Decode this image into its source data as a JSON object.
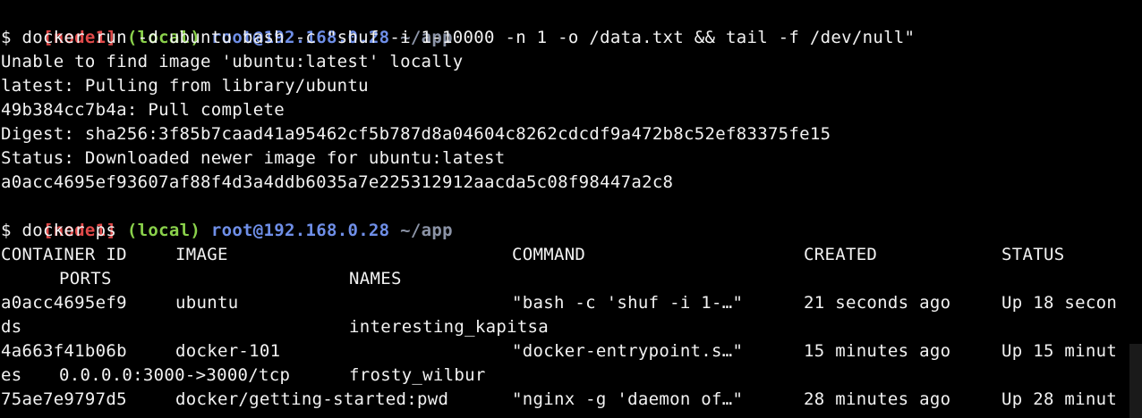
{
  "prompt": {
    "node": "[node1]",
    "local": "(local)",
    "host": "root@192.168.0.28",
    "path": "~/app"
  },
  "session": [
    {
      "kind": "prompt"
    },
    {
      "kind": "text",
      "text": "$ docker run -d ubuntu bash -c \"shuf -i 1-10000 -n 1 -o /data.txt && tail -f /dev/null\""
    },
    {
      "kind": "text",
      "text": "Unable to find image 'ubuntu:latest' locally"
    },
    {
      "kind": "text",
      "text": "latest: Pulling from library/ubuntu"
    },
    {
      "kind": "text",
      "text": "49b384cc7b4a: Pull complete"
    },
    {
      "kind": "text",
      "text": "Digest: sha256:3f85b7caad41a95462cf5b787d8a04604c8262cdcdf9a472b8c52ef83375fe15"
    },
    {
      "kind": "text",
      "text": "Status: Downloaded newer image for ubuntu:latest"
    },
    {
      "kind": "text",
      "text": "a0acc4695ef93607af88f4d3a4ddb6035a7e225312912aacda5c08f98447a2c8"
    },
    {
      "kind": "prompt"
    },
    {
      "kind": "text",
      "text": "$ docker ps"
    }
  ],
  "table": {
    "headers": [
      "CONTAINER ID",
      "IMAGE",
      "COMMAND",
      "CREATED",
      "STATUS"
    ],
    "headers_wrap": [
      "PORTS",
      "NAMES"
    ],
    "rows": [
      {
        "id": "a0acc4695ef9",
        "image": "ubuntu",
        "command": "\"bash -c 'shuf -i 1-…\"",
        "created": "21 seconds ago",
        "status": "Up 18 secon",
        "wrap_status": "ds",
        "ports": "",
        "names": "interesting_kapitsa"
      },
      {
        "id": "4a663f41b06b",
        "image": "docker-101",
        "command": "\"docker-entrypoint.s…\"",
        "created": "15 minutes ago",
        "status": "Up 15 minut",
        "wrap_status": "es",
        "ports": "0.0.0.0:3000->3000/tcp",
        "names": "frosty_wilbur"
      },
      {
        "id": "75ae7e9797d5",
        "image": "docker/getting-started:pwd",
        "command": "\"nginx -g 'daemon of…\"",
        "created": "28 minutes ago",
        "status": "Up 28 minut"
      }
    ]
  }
}
